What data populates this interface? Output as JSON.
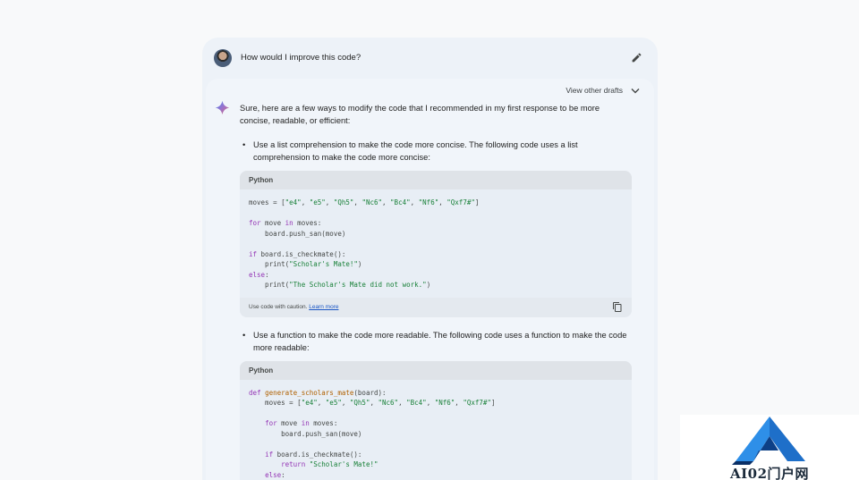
{
  "prompt": {
    "text": "How would I improve this code?"
  },
  "response": {
    "drafts_label": "View other drafts",
    "intro": "Sure, here are a few ways to modify the code that I recommended in my first response to be more concise, readable, or efficient:",
    "bullets": [
      {
        "text": "Use a list comprehension to make the code more concise. The following code uses a list comprehension to make the code more concise:",
        "language": "Python",
        "caution_text": "Use code with caution.",
        "learn_more": "Learn more"
      },
      {
        "text": "Use a function to make the code more readable. The following code uses a function to make the code more readable:",
        "language": "Python"
      }
    ]
  },
  "watermark": {
    "text": "AI02门户网"
  },
  "colors": {
    "keyword": "#9334b5",
    "string": "#188038",
    "function": "#b06000",
    "link": "#1a56c4",
    "logo_blue": "#1e6fc9"
  },
  "icons": [
    "avatar",
    "edit-icon",
    "chevron-down-icon",
    "gemini-sparkle-icon",
    "copy-icon"
  ]
}
